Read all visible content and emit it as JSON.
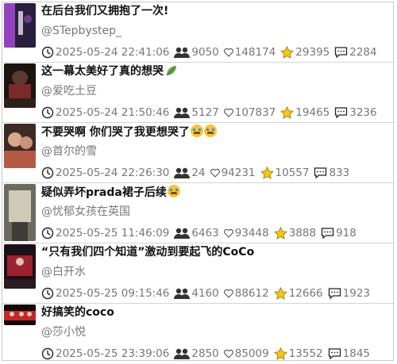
{
  "feed": [
    {
      "title": "在后台我们又拥抱了一次!",
      "emoji": "",
      "author": "@STepbystep_",
      "time": "2025-05-24 22:41:06",
      "views": "9050",
      "likes": "148174",
      "favorites": "29395",
      "comments": "2284",
      "thumb_colors": [
        "#2a1f3d",
        "#a64ad6"
      ]
    },
    {
      "title": "这一幕太美好了真的想哭",
      "emoji": "leaf",
      "author": "@爱吃土豆",
      "time": "2025-05-24 21:50:46",
      "views": "5127",
      "likes": "107837",
      "favorites": "19465",
      "comments": "3236",
      "thumb_colors": [
        "#1c1410",
        "#7a2a2a"
      ]
    },
    {
      "title": "不要哭啊 你们哭了我更想哭了",
      "emoji": "crying-x2",
      "author": "@首尔的雪",
      "time": "2025-05-24 22:26:30",
      "views": "24",
      "likes": "94231",
      "favorites": "10557",
      "comments": "833",
      "thumb_colors": [
        "#3b2b24",
        "#b35a45"
      ]
    },
    {
      "title": "疑似弄坏prada裙子后续",
      "emoji": "crying",
      "author": "@忧郁女孩在英国",
      "time": "2025-05-25 11:46:09",
      "views": "6463",
      "likes": "93448",
      "favorites": "3888",
      "comments": "918",
      "thumb_colors": [
        "#6b6a60",
        "#cfc9b8"
      ]
    },
    {
      "title": "“只有我们四个知道”激动到要起飞的CoCo",
      "emoji": "",
      "author": "@白开水",
      "time": "2025-05-25 09:15:46",
      "views": "4160",
      "likes": "88612",
      "favorites": "12666",
      "comments": "1923",
      "thumb_colors": [
        "#1a1018",
        "#9c2230"
      ]
    },
    {
      "title": "好搞笑的coco",
      "emoji": "",
      "author": "@莎小悦",
      "time": "2025-05-25 23:39:06",
      "views": "2850",
      "likes": "85009",
      "favorites": "13552",
      "comments": "1845",
      "thumb_colors": [
        "#140a0a",
        "#c4262a"
      ]
    }
  ]
}
